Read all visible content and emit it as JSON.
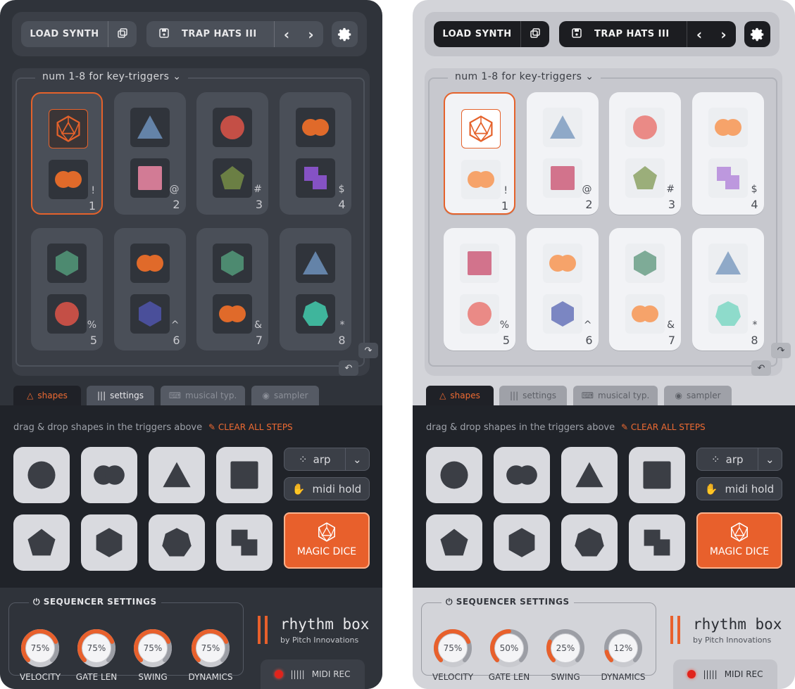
{
  "topbar": {
    "load_label": "LOAD SYNTH",
    "preset_name": "TRAP HATS III",
    "prev": "‹",
    "next": "›"
  },
  "grid": {
    "key_hint": "num 1-8 for key-triggers",
    "triggers_dark": [
      {
        "num": "1",
        "sym": "!",
        "top": "dice",
        "bottom": "double-circle"
      },
      {
        "num": "2",
        "sym": "@",
        "top": "triangle",
        "bottom": "square"
      },
      {
        "num": "3",
        "sym": "#",
        "top": "circle",
        "bottom": "pentagon"
      },
      {
        "num": "4",
        "sym": "$",
        "top": "double-circle",
        "bottom": "stairs"
      },
      {
        "num": "5",
        "sym": "%",
        "top": "hexagon",
        "bottom": "circle"
      },
      {
        "num": "6",
        "sym": "^",
        "top": "double-circle",
        "bottom": "hexagon-blue"
      },
      {
        "num": "7",
        "sym": "&",
        "top": "hexagon",
        "bottom": "double-circle"
      },
      {
        "num": "8",
        "sym": "*",
        "top": "triangle",
        "bottom": "heptagon"
      }
    ],
    "triggers_light": [
      {
        "num": "1",
        "sym": "!",
        "top": "dice",
        "bottom": "double-circle"
      },
      {
        "num": "2",
        "sym": "@",
        "top": "triangle",
        "bottom": "square"
      },
      {
        "num": "3",
        "sym": "#",
        "top": "circle",
        "bottom": "pentagon"
      },
      {
        "num": "4",
        "sym": "$",
        "top": "double-circle",
        "bottom": "stairs"
      },
      {
        "num": "5",
        "sym": "%",
        "top": "square",
        "bottom": "circle"
      },
      {
        "num": "6",
        "sym": "^",
        "top": "double-circle",
        "bottom": "hexagon-blue"
      },
      {
        "num": "7",
        "sym": "&",
        "top": "hexagon",
        "bottom": "double-circle"
      },
      {
        "num": "8",
        "sym": "*",
        "top": "triangle",
        "bottom": "heptagon"
      }
    ]
  },
  "tabs": {
    "shapes": "shapes",
    "settings": "settings",
    "musical": "musical typ.",
    "sampler": "sampler"
  },
  "lower": {
    "hint": "drag & drop shapes in the triggers above",
    "clear": "CLEAR ALL STEPS",
    "arp": "arp",
    "midi_hold": "midi hold",
    "magic": "MAGIC DICE"
  },
  "sequencer": {
    "title": "SEQUENCER SETTINGS",
    "labels": [
      "VELOCITY",
      "GATE LEN",
      "SWING",
      "DYNAMICS"
    ],
    "dark_values": [
      "75%",
      "75%",
      "75%",
      "75%"
    ],
    "light_values": [
      "75%",
      "50%",
      "25%",
      "12%"
    ]
  },
  "brand": {
    "name": "rhythm box",
    "by": "by Pitch Innovations",
    "midi_rec": "MIDI REC"
  },
  "colors": {
    "accent": "#e8602c",
    "red": "#c9564d",
    "blue": "#6f8fb0",
    "pink": "#d8788f",
    "green": "#6a7e4d",
    "purple": "#8a5cc2",
    "teal": "#3fae94",
    "navy": "#4e55a0",
    "orange": "#e36a2c"
  }
}
